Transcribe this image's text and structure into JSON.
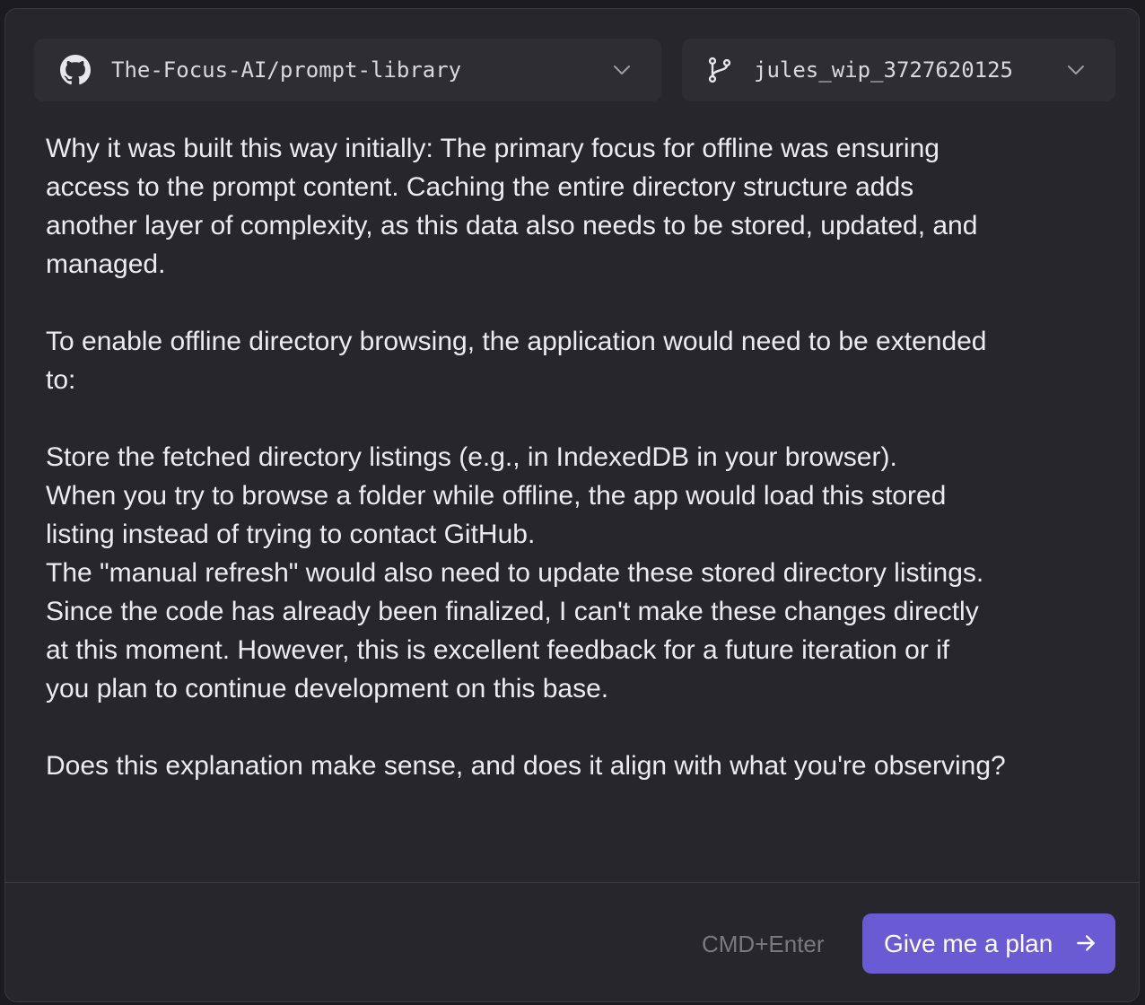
{
  "repo_selector": {
    "label": "The-Focus-AI/prompt-library",
    "icon": "github-icon"
  },
  "branch_selector": {
    "label": "jules_wip_3727620125",
    "icon": "git-branch-icon"
  },
  "message": {
    "lines": [
      "Why it was built this way initially: The primary focus for offline was ensuring",
      "access to the prompt content. Caching the entire directory structure adds",
      "another layer of complexity, as this data also needs to be stored, updated, and",
      "managed.",
      "To enable offline directory browsing, the application would need to be extended",
      "to:",
      "Store the fetched directory listings (e.g., in IndexedDB in your browser).",
      "When you try to browse a folder while offline, the app would load this stored",
      "listing instead of trying to contact GitHub.",
      "The \"manual refresh\" would also need to update these stored directory listings.",
      "Since the code has already been finalized, I can't make these changes directly",
      "at this moment. However, this is excellent feedback for a future iteration or if",
      "you plan to continue development on this base.",
      "Does this explanation make sense, and does it align with what you're observing?"
    ]
  },
  "footer": {
    "shortcut_hint": "CMD+Enter",
    "plan_button_label": "Give me a plan",
    "plan_button_icon": "arrow-right-icon"
  },
  "colors": {
    "background": "#27262c",
    "selector_background": "#2e2d33",
    "text": "#ececf0",
    "muted_text": "#7a7980",
    "accent": "#6a5ad3"
  }
}
